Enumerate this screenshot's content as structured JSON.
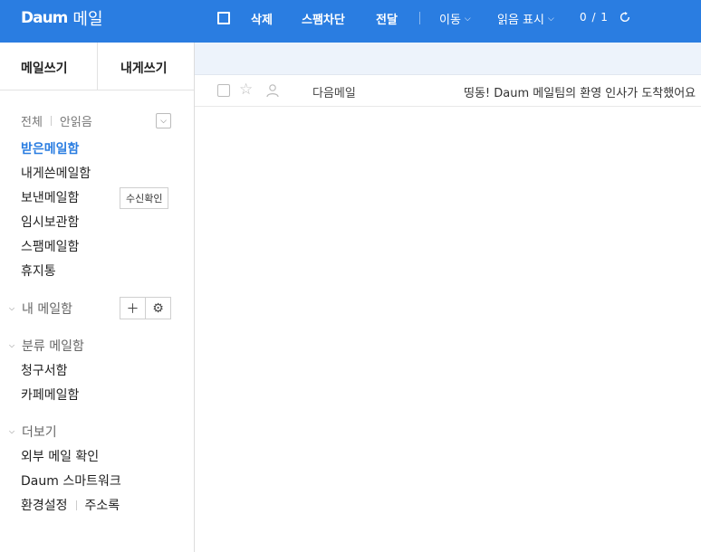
{
  "topbar": {
    "logo_mark": "Daum",
    "app_name": "메일",
    "actions": [
      "삭제",
      "스팸차단",
      "전달"
    ],
    "menus": [
      "이동",
      "읽음 표시"
    ],
    "count": "0 / 1"
  },
  "sidebar": {
    "compose": [
      "메일쓰기",
      "내게쓰기"
    ],
    "filter": {
      "all": "전체",
      "unread": "안읽음"
    },
    "folders": [
      "받은메일함",
      "내게쓴메일함",
      "보낸메일함",
      "임시보관함",
      "스팸메일함",
      "휴지통"
    ],
    "receipt_button": "수신확인",
    "my_mail": "내 메일함",
    "category_mail": "분류 메일함",
    "category_items": [
      "청구서함",
      "카페메일함"
    ],
    "more": "더보기",
    "more_items": [
      "외부 메일 확인",
      "Daum 스마트워크",
      "환경설정",
      "주소록"
    ]
  },
  "mail_list": [
    {
      "sender": "다음메일",
      "subject": "띵동! Daum 메일팀의 환영 인사가 도착했어요"
    }
  ],
  "colors": {
    "brand": "#2a7de1",
    "banner": "#edf3fb"
  }
}
